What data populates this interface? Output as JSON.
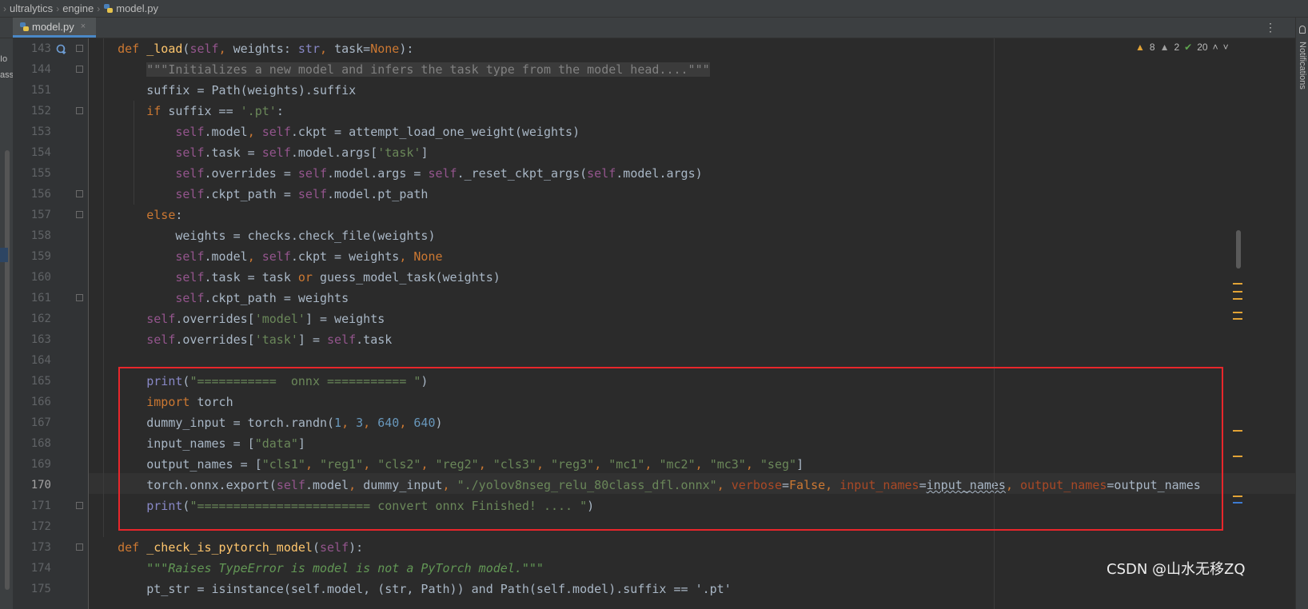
{
  "breadcrumb": {
    "items": [
      "ultralytics",
      "engine",
      "model.py"
    ]
  },
  "tab": {
    "label": "model.py",
    "close": "×"
  },
  "tab_menu": "⋮",
  "right_panel": {
    "label": "Notifications"
  },
  "left_panel": {
    "fragments": [
      "Io",
      "ass"
    ]
  },
  "inspections": {
    "warnings": "8",
    "weak_warnings": "2",
    "ok": "20"
  },
  "line_numbers": [
    "143",
    "144",
    "151",
    "152",
    "153",
    "154",
    "155",
    "156",
    "157",
    "158",
    "159",
    "160",
    "161",
    "162",
    "163",
    "164",
    "165",
    "166",
    "167",
    "168",
    "169",
    "170",
    "171",
    "172",
    "173",
    "174",
    "175"
  ],
  "current_line": "170",
  "code_lines": [
    [
      {
        "t": "    "
      },
      {
        "t": "def ",
        "c": "kw"
      },
      {
        "t": "_load",
        "c": "fn"
      },
      {
        "t": "("
      },
      {
        "t": "self",
        "c": "sf"
      },
      {
        "t": ", ",
        "c": "kw"
      },
      {
        "t": "weights: "
      },
      {
        "t": "str",
        "c": "bi"
      },
      {
        "t": ", ",
        "c": "kw"
      },
      {
        "t": "task="
      },
      {
        "t": "None",
        "c": "kw"
      },
      {
        "t": "):"
      }
    ],
    [
      {
        "t": "        "
      },
      {
        "t": "\"\"\"Initializes a new model and infers the task type from the model head....\"\"\"",
        "c": "fd"
      }
    ],
    [
      {
        "t": "        suffix = Path(weights).suffix"
      }
    ],
    [
      {
        "t": "        "
      },
      {
        "t": "if ",
        "c": "kw"
      },
      {
        "t": "suffix == "
      },
      {
        "t": "'.pt'",
        "c": "st"
      },
      {
        "t": ":"
      }
    ],
    [
      {
        "t": "            "
      },
      {
        "t": "self",
        "c": "sf"
      },
      {
        "t": ".model"
      },
      {
        "t": ", ",
        "c": "kw"
      },
      {
        "t": "self",
        "c": "sf"
      },
      {
        "t": ".ckpt = attempt_load_one_weight(weights)"
      }
    ],
    [
      {
        "t": "            "
      },
      {
        "t": "self",
        "c": "sf"
      },
      {
        "t": ".task = "
      },
      {
        "t": "self",
        "c": "sf"
      },
      {
        "t": ".model.args["
      },
      {
        "t": "'task'",
        "c": "st"
      },
      {
        "t": "]"
      }
    ],
    [
      {
        "t": "            "
      },
      {
        "t": "self",
        "c": "sf"
      },
      {
        "t": ".overrides = "
      },
      {
        "t": "self",
        "c": "sf"
      },
      {
        "t": ".model.args = "
      },
      {
        "t": "self",
        "c": "sf"
      },
      {
        "t": "._reset_ckpt_args("
      },
      {
        "t": "self",
        "c": "sf"
      },
      {
        "t": ".model.args)"
      }
    ],
    [
      {
        "t": "            "
      },
      {
        "t": "self",
        "c": "sf"
      },
      {
        "t": ".ckpt_path = "
      },
      {
        "t": "self",
        "c": "sf"
      },
      {
        "t": ".model.pt_path"
      }
    ],
    [
      {
        "t": "        "
      },
      {
        "t": "else",
        "c": "kw"
      },
      {
        "t": ":"
      }
    ],
    [
      {
        "t": "            weights = checks.check_file(weights)"
      }
    ],
    [
      {
        "t": "            "
      },
      {
        "t": "self",
        "c": "sf"
      },
      {
        "t": ".model"
      },
      {
        "t": ", ",
        "c": "kw"
      },
      {
        "t": "self",
        "c": "sf"
      },
      {
        "t": ".ckpt = weights"
      },
      {
        "t": ", ",
        "c": "kw"
      },
      {
        "t": "None",
        "c": "kw"
      }
    ],
    [
      {
        "t": "            "
      },
      {
        "t": "self",
        "c": "sf"
      },
      {
        "t": ".task = task "
      },
      {
        "t": "or ",
        "c": "kw"
      },
      {
        "t": "guess_model_task(weights)"
      }
    ],
    [
      {
        "t": "            "
      },
      {
        "t": "self",
        "c": "sf"
      },
      {
        "t": ".ckpt_path = weights"
      }
    ],
    [
      {
        "t": "        "
      },
      {
        "t": "self",
        "c": "sf"
      },
      {
        "t": ".overrides["
      },
      {
        "t": "'model'",
        "c": "st"
      },
      {
        "t": "] = weights"
      }
    ],
    [
      {
        "t": "        "
      },
      {
        "t": "self",
        "c": "sf"
      },
      {
        "t": ".overrides["
      },
      {
        "t": "'task'",
        "c": "st"
      },
      {
        "t": "] = "
      },
      {
        "t": "self",
        "c": "sf"
      },
      {
        "t": ".task"
      }
    ],
    [
      {
        "t": ""
      }
    ],
    [
      {
        "t": "        "
      },
      {
        "t": "print",
        "c": "bi"
      },
      {
        "t": "("
      },
      {
        "t": "\"===========  onnx =========== \"",
        "c": "st"
      },
      {
        "t": ")"
      }
    ],
    [
      {
        "t": "        "
      },
      {
        "t": "import ",
        "c": "kw"
      },
      {
        "t": "torch"
      }
    ],
    [
      {
        "t": "        dummy_input = torch.randn("
      },
      {
        "t": "1",
        "c": "nm"
      },
      {
        "t": ", ",
        "c": "kw"
      },
      {
        "t": "3",
        "c": "nm"
      },
      {
        "t": ", ",
        "c": "kw"
      },
      {
        "t": "640",
        "c": "nm"
      },
      {
        "t": ", ",
        "c": "kw"
      },
      {
        "t": "640",
        "c": "nm"
      },
      {
        "t": ")"
      }
    ],
    [
      {
        "t": "        input_names = ["
      },
      {
        "t": "\"data\"",
        "c": "st"
      },
      {
        "t": "]"
      }
    ],
    [
      {
        "t": "        output_names = ["
      },
      {
        "t": "\"cls1\"",
        "c": "st"
      },
      {
        "t": ", ",
        "c": "kw"
      },
      {
        "t": "\"reg1\"",
        "c": "st"
      },
      {
        "t": ", ",
        "c": "kw"
      },
      {
        "t": "\"cls2\"",
        "c": "st"
      },
      {
        "t": ", ",
        "c": "kw"
      },
      {
        "t": "\"reg2\"",
        "c": "st"
      },
      {
        "t": ", ",
        "c": "kw"
      },
      {
        "t": "\"cls3\"",
        "c": "st"
      },
      {
        "t": ", ",
        "c": "kw"
      },
      {
        "t": "\"reg3\"",
        "c": "st"
      },
      {
        "t": ", ",
        "c": "kw"
      },
      {
        "t": "\"mc1\"",
        "c": "st"
      },
      {
        "t": ", ",
        "c": "kw"
      },
      {
        "t": "\"mc2\"",
        "c": "st"
      },
      {
        "t": ", ",
        "c": "kw"
      },
      {
        "t": "\"mc3\"",
        "c": "st"
      },
      {
        "t": ", ",
        "c": "kw"
      },
      {
        "t": "\"seg\"",
        "c": "st"
      },
      {
        "t": "]"
      }
    ],
    [
      {
        "t": "        torch.onnx.export("
      },
      {
        "t": "self",
        "c": "sf"
      },
      {
        "t": ".model"
      },
      {
        "t": ", ",
        "c": "kw"
      },
      {
        "t": "dummy_input"
      },
      {
        "t": ", ",
        "c": "kw"
      },
      {
        "t": "\"./yolov8nseg_relu_80class_dfl.onnx\"",
        "c": "st"
      },
      {
        "t": ", ",
        "c": "kw"
      },
      {
        "t": "verbose",
        "c": "pr"
      },
      {
        "t": "="
      },
      {
        "t": "False",
        "c": "kw"
      },
      {
        "t": ", ",
        "c": "kw"
      },
      {
        "t": "input_names",
        "c": "pr"
      },
      {
        "t": "="
      },
      {
        "t": "input_names",
        "c": "squig"
      },
      {
        "t": ", ",
        "c": "kw"
      },
      {
        "t": "output_names",
        "c": "pr"
      },
      {
        "t": "=output_names"
      }
    ],
    [
      {
        "t": "        "
      },
      {
        "t": "print",
        "c": "bi"
      },
      {
        "t": "("
      },
      {
        "t": "\"======================== convert onnx Finished! .... \"",
        "c": "st"
      },
      {
        "t": ")"
      }
    ],
    [
      {
        "t": ""
      }
    ],
    [
      {
        "t": "    "
      },
      {
        "t": "def ",
        "c": "kw"
      },
      {
        "t": "_check_is_pytorch_model",
        "c": "fn"
      },
      {
        "t": "("
      },
      {
        "t": "self",
        "c": "sf"
      },
      {
        "t": "):"
      }
    ],
    [
      {
        "t": "        "
      },
      {
        "t": "\"\"\"Raises TypeError is model is not a PyTorch model.\"\"\"",
        "c": "dc"
      }
    ],
    [
      {
        "t": "        pt_str = isinstance(self.model, (str, Path)) and Path(self.model).suffix == '.pt'"
      }
    ]
  ],
  "watermark": "CSDN @山水无移ZQ"
}
